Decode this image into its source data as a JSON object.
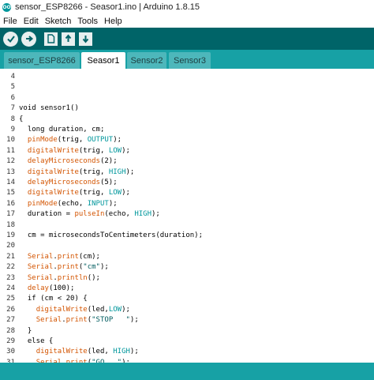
{
  "window": {
    "title": "sensor_ESP8266 - Seasor1.ino | Arduino 1.8.15",
    "icon": "arduino-logo-icon",
    "icon_text": "OO"
  },
  "menu": [
    "File",
    "Edit",
    "Sketch",
    "Tools",
    "Help"
  ],
  "toolbar": {
    "buttons": [
      {
        "name": "verify-button",
        "icon": "checkmark-icon"
      },
      {
        "name": "upload-button",
        "icon": "arrow-right-icon"
      },
      {
        "name": "new-button",
        "icon": "new-file-icon"
      },
      {
        "name": "open-button",
        "icon": "arrow-up-icon"
      },
      {
        "name": "save-button",
        "icon": "arrow-down-icon"
      }
    ]
  },
  "tabs": [
    {
      "label": "sensor_ESP8266",
      "active": false
    },
    {
      "label": "Seasor1",
      "active": true
    },
    {
      "label": "Sensor2",
      "active": false
    },
    {
      "label": "Sensor3",
      "active": false
    }
  ],
  "editor": {
    "lines": [
      {
        "n": "4",
        "text": ""
      },
      {
        "n": "5",
        "text": ""
      },
      {
        "n": "6",
        "text": ""
      },
      {
        "n": "7",
        "text": "void sensor1()"
      },
      {
        "n": "8",
        "text": "{"
      },
      {
        "n": "9",
        "text": "  long duration, cm;"
      },
      {
        "n": "10",
        "text": "  pinMode(trig, OUTPUT);"
      },
      {
        "n": "11",
        "text": "  digitalWrite(trig, LOW);"
      },
      {
        "n": "12",
        "text": "  delayMicroseconds(2);"
      },
      {
        "n": "13",
        "text": "  digitalWrite(trig, HIGH);"
      },
      {
        "n": "14",
        "text": "  delayMicroseconds(5);"
      },
      {
        "n": "15",
        "text": "  digitalWrite(trig, LOW);"
      },
      {
        "n": "16",
        "text": "  pinMode(echo, INPUT);"
      },
      {
        "n": "17",
        "text": "  duration = pulseIn(echo, HIGH);"
      },
      {
        "n": "18",
        "text": ""
      },
      {
        "n": "19",
        "text": "  cm = microsecondsToCentimeters(duration);"
      },
      {
        "n": "20",
        "text": ""
      },
      {
        "n": "21",
        "text": "  Serial.print(cm);"
      },
      {
        "n": "22",
        "text": "  Serial.print(\"cm\");"
      },
      {
        "n": "23",
        "text": "  Serial.println();"
      },
      {
        "n": "24",
        "text": "  delay(100);"
      },
      {
        "n": "25",
        "text": "  if (cm < 20) {"
      },
      {
        "n": "26",
        "text": "    digitalWrite(led,LOW);"
      },
      {
        "n": "27",
        "text": "    Serial.print(\"STOP   \");"
      },
      {
        "n": "28",
        "text": "  }"
      },
      {
        "n": "29",
        "text": "  else {"
      },
      {
        "n": "30",
        "text": "    digitalWrite(led, HIGH);"
      },
      {
        "n": "31",
        "text": "    Serial.print(\"GO   \");"
      }
    ]
  },
  "colors": {
    "toolbar_bg": "#006468",
    "tabbar_bg": "#17a1a5",
    "tab_inactive": "#4db7bb",
    "keyword_fn": "#d35400",
    "keyword_const": "#00979c",
    "string": "#005c5f"
  }
}
